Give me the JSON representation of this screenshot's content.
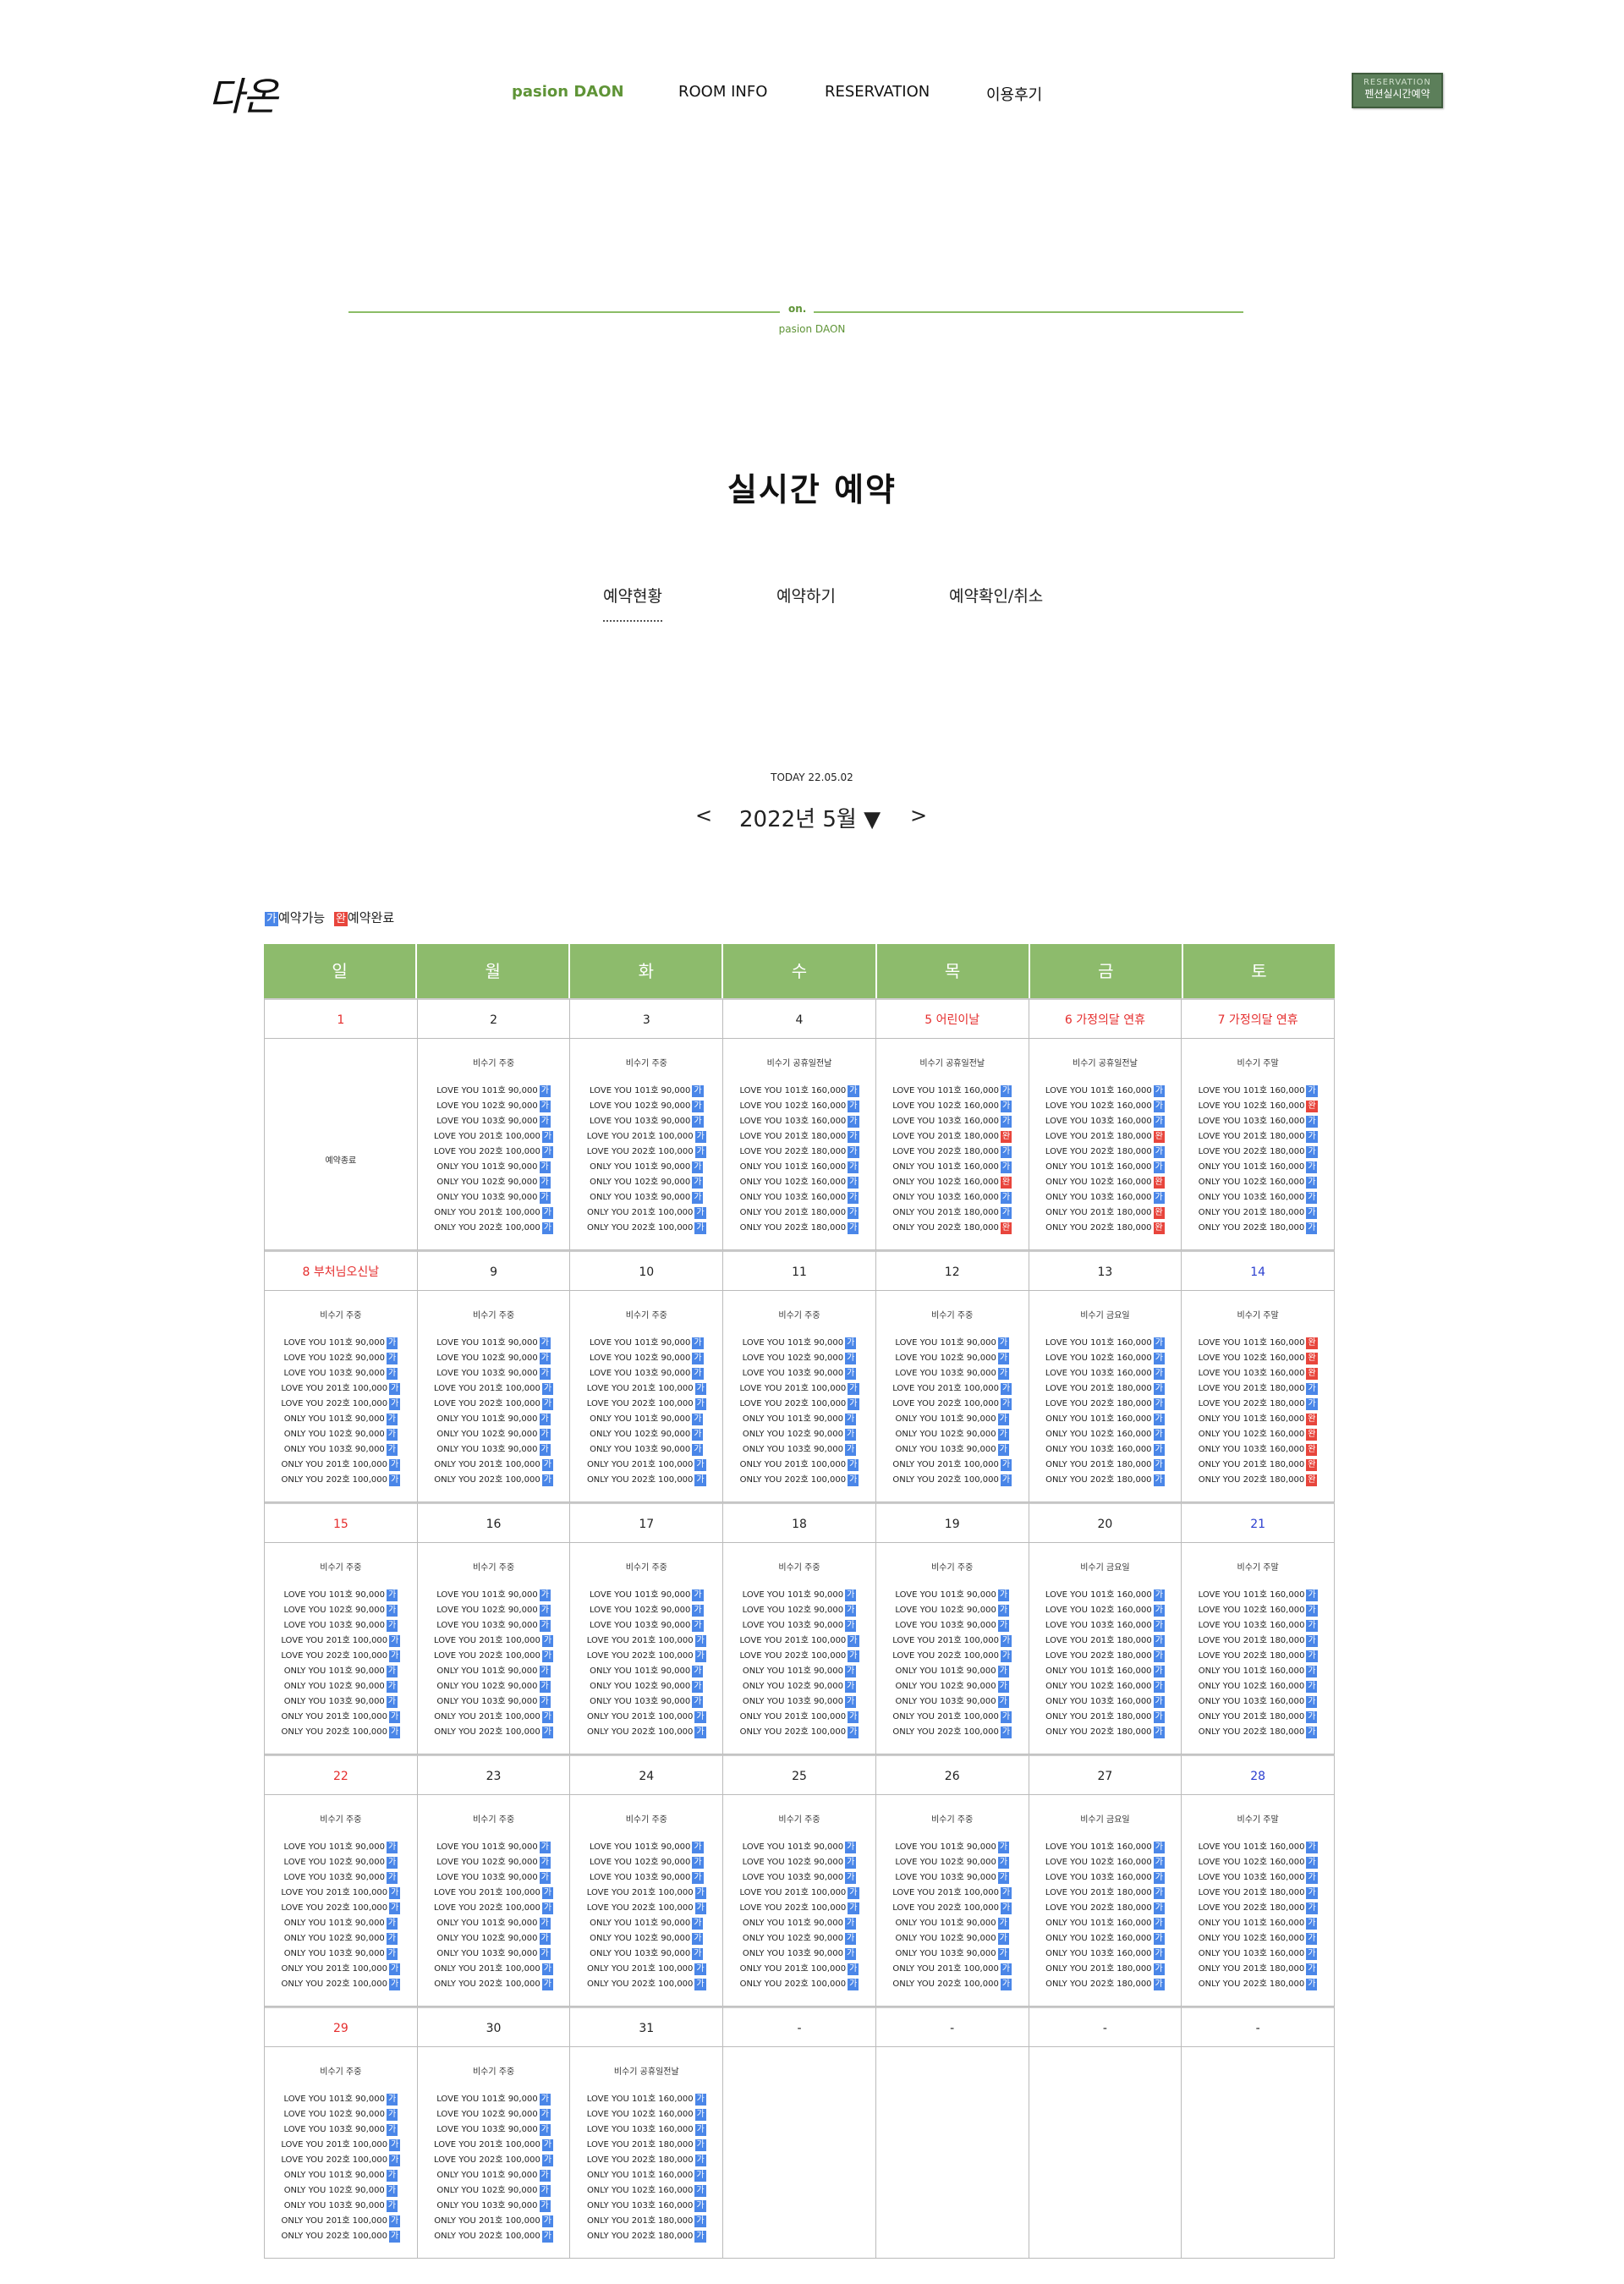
{
  "header": {
    "logo": "다온",
    "nav": [
      "pasion DAON",
      "ROOM INFO",
      "RESERVATION",
      "이용후기"
    ],
    "realtime_button_small": "RESERVATION",
    "realtime_button": "펜션실시간예약"
  },
  "divider": {
    "label": "on.",
    "sub": "pasion DAON"
  },
  "page_title": "실시간 예약",
  "tabs": [
    "예약현황",
    "예약하기",
    "예약확인/취소"
  ],
  "today": "TODAY 22.05.02",
  "month": {
    "label": "2022년 5월 ▼",
    "prev": "<",
    "next": ">"
  },
  "legend": {
    "available_badge": "가",
    "available_label": "예약가능",
    "done_badge": "완",
    "done_label": "예약완료"
  },
  "colors": {
    "accent": "#8dbb6c",
    "available": "#4a86e8",
    "done": "#e8453c",
    "holiday": "#e52d2d",
    "saturday": "#2b3ecf"
  },
  "weekdays": [
    "일",
    "월",
    "화",
    "수",
    "목",
    "금",
    "토"
  ],
  "weeks": [
    {
      "days": [
        {
          "date": "1",
          "color": "red",
          "closed": "예약종료"
        },
        {
          "date": "2",
          "season": "비수기 주중",
          "price": "w"
        },
        {
          "date": "3",
          "season": "비수기 주중",
          "price": "w"
        },
        {
          "date": "4",
          "season": "비수기 공휴일전날",
          "price": "h",
          "done": [
            10
          ]
        },
        {
          "date": "5 어린이날",
          "color": "red",
          "season": "비수기 공휴일전날",
          "price": "h",
          "done": [
            3,
            6,
            9
          ]
        },
        {
          "date": "6 가정의달 연휴",
          "color": "red",
          "season": "비수기 공휴일전날",
          "price": "h",
          "done": [
            3,
            6,
            8,
            9
          ]
        },
        {
          "date": "7 가정의달 연휴",
          "color": "red",
          "season": "비수기 주말",
          "price": "h",
          "done": [
            1
          ]
        }
      ]
    },
    {
      "days": [
        {
          "date": "8 부처님오신날",
          "color": "red",
          "season": "비수기 주중",
          "price": "w"
        },
        {
          "date": "9",
          "season": "비수기 주중",
          "price": "w"
        },
        {
          "date": "10",
          "season": "비수기 주중",
          "price": "w"
        },
        {
          "date": "11",
          "season": "비수기 주중",
          "price": "w"
        },
        {
          "date": "12",
          "season": "비수기 주중",
          "price": "w"
        },
        {
          "date": "13",
          "season": "비수기 금요일",
          "price": "f"
        },
        {
          "date": "14",
          "color": "blue",
          "season": "비수기 주말",
          "price": "h",
          "done": [
            0,
            1,
            2,
            5,
            6,
            7,
            8,
            9
          ]
        }
      ]
    },
    {
      "days": [
        {
          "date": "15",
          "color": "red",
          "season": "비수기 주중",
          "price": "w"
        },
        {
          "date": "16",
          "season": "비수기 주중",
          "price": "w"
        },
        {
          "date": "17",
          "season": "비수기 주중",
          "price": "w"
        },
        {
          "date": "18",
          "season": "비수기 주중",
          "price": "w"
        },
        {
          "date": "19",
          "season": "비수기 주중",
          "price": "w"
        },
        {
          "date": "20",
          "season": "비수기 금요일",
          "price": "f"
        },
        {
          "date": "21",
          "color": "blue",
          "season": "비수기 주말",
          "price": "h"
        }
      ]
    },
    {
      "days": [
        {
          "date": "22",
          "color": "red",
          "season": "비수기 주중",
          "price": "w"
        },
        {
          "date": "23",
          "season": "비수기 주중",
          "price": "w"
        },
        {
          "date": "24",
          "season": "비수기 주중",
          "price": "w"
        },
        {
          "date": "25",
          "season": "비수기 주중",
          "price": "w"
        },
        {
          "date": "26",
          "season": "비수기 주중",
          "price": "w"
        },
        {
          "date": "27",
          "season": "비수기 금요일",
          "price": "f"
        },
        {
          "date": "28",
          "color": "blue",
          "season": "비수기 주말",
          "price": "h"
        }
      ]
    },
    {
      "days": [
        {
          "date": "29",
          "color": "red",
          "season": "비수기 주중",
          "price": "w"
        },
        {
          "date": "30",
          "season": "비수기 주중",
          "price": "w"
        },
        {
          "date": "31",
          "season": "비수기 공휴일전날",
          "price": "h"
        },
        {
          "date": "-",
          "empty": true
        },
        {
          "date": "-",
          "empty": true
        },
        {
          "date": "-",
          "empty": true
        },
        {
          "date": "-",
          "empty": true
        }
      ]
    }
  ],
  "rooms": [
    "LOVE YOU 101호",
    "LOVE YOU 102호",
    "LOVE YOU 103호",
    "LOVE YOU 201호",
    "LOVE YOU 202호",
    "ONLY YOU 101호",
    "ONLY YOU 102호",
    "ONLY YOU 103호",
    "ONLY YOU 201호",
    "ONLY YOU 202호"
  ],
  "prices": {
    "w": [
      "90,000",
      "90,000",
      "90,000",
      "100,000",
      "100,000",
      "90,000",
      "90,000",
      "90,000",
      "100,000",
      "100,000"
    ],
    "f": [
      "160,000",
      "160,000",
      "160,000",
      "180,000",
      "180,000",
      "160,000",
      "160,000",
      "160,000",
      "180,000",
      "180,000"
    ],
    "h": [
      "160,000",
      "160,000",
      "160,000",
      "180,000",
      "180,000",
      "160,000",
      "160,000",
      "160,000",
      "180,000",
      "180,000"
    ]
  }
}
